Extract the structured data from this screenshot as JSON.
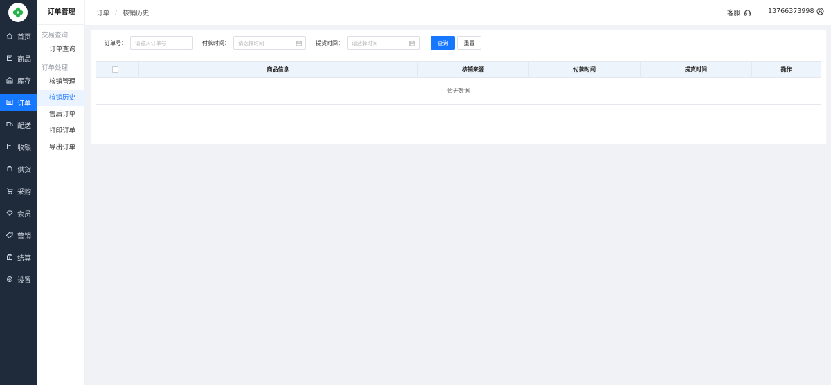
{
  "nav": {
    "items": [
      {
        "label": "首页",
        "icon": "home-icon"
      },
      {
        "label": "商品",
        "icon": "box-icon"
      },
      {
        "label": "库存",
        "icon": "warehouse-icon"
      },
      {
        "label": "订单",
        "icon": "order-icon",
        "active": true
      },
      {
        "label": "配送",
        "icon": "truck-icon"
      },
      {
        "label": "收银",
        "icon": "cashier-icon"
      },
      {
        "label": "供货",
        "icon": "supply-icon"
      },
      {
        "label": "采购",
        "icon": "cart-icon"
      },
      {
        "label": "会员",
        "icon": "member-icon"
      },
      {
        "label": "营销",
        "icon": "tag-icon"
      },
      {
        "label": "结算",
        "icon": "settle-icon"
      },
      {
        "label": "设置",
        "icon": "gear-icon"
      }
    ],
    "active_color": "#1677ff"
  },
  "submenu": {
    "title": "订单管理",
    "groups": [
      {
        "label": "交易查询",
        "items": [
          "订单查询"
        ]
      },
      {
        "label": "订单处理",
        "items": [
          "核销管理",
          "核销历史",
          "售后订单",
          "打印订单",
          "导出订单"
        ]
      }
    ],
    "active_item": "核销历史"
  },
  "header": {
    "breadcrumb": [
      "订单",
      "核销历史"
    ],
    "service_label": "客服",
    "user_phone": "13766373998"
  },
  "filters": {
    "order_no_label": "订单号：",
    "order_no_placeholder": "请输入订单号",
    "pay_time_label": "付款时间：",
    "pay_time_placeholder": "请选择时间",
    "pickup_time_label": "提货时间：",
    "pickup_time_placeholder": "请选择时间",
    "search_button": "查询",
    "reset_button": "重置"
  },
  "table": {
    "columns": [
      "商品信息",
      "核销来源",
      "付款时间",
      "提货时间",
      "操作"
    ],
    "empty_text": "暂无数据"
  }
}
